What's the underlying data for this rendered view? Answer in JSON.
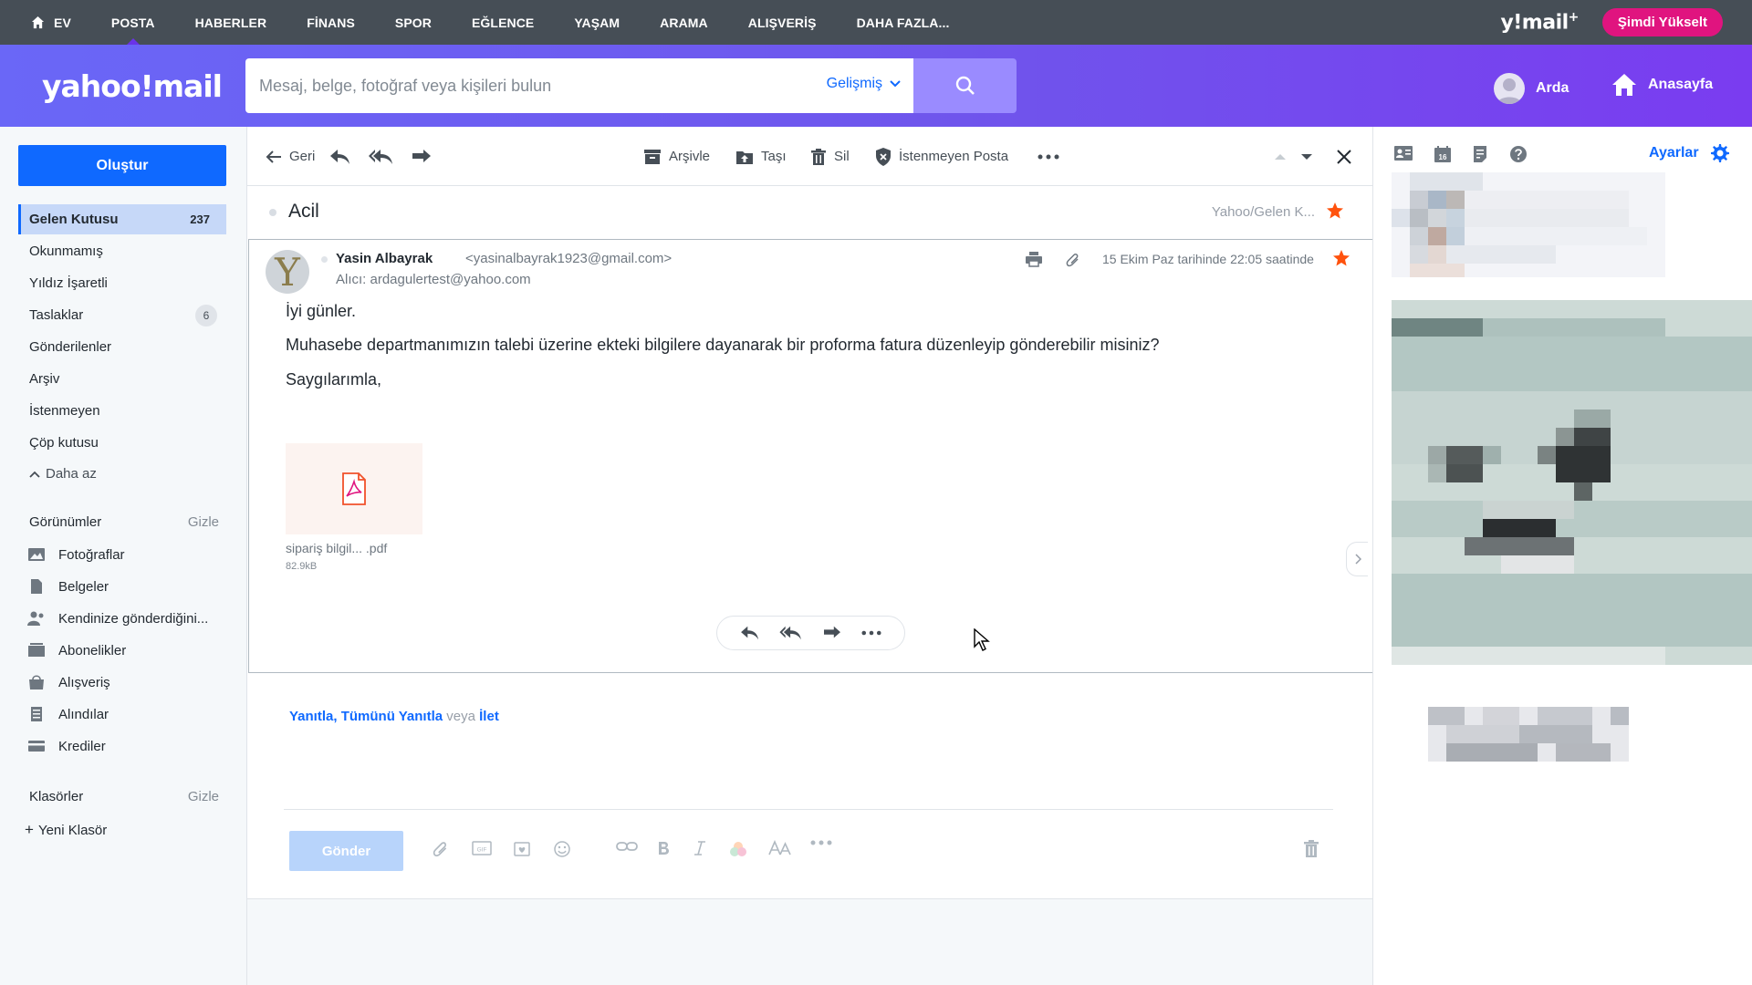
{
  "topnav": {
    "items": [
      "EV",
      "POSTA",
      "HABERLER",
      "FİNANS",
      "SPOR",
      "EĞLENCE",
      "YAŞAM",
      "ARAMA",
      "ALIŞVERİŞ",
      "DAHA FAZLA..."
    ],
    "brand": "y!mail",
    "brand_plus": "+",
    "upgrade": "Şimdi Yükselt"
  },
  "header": {
    "logo": "yahoo!mail",
    "search_placeholder": "Mesaj, belge, fotoğraf veya kişileri bulun",
    "advanced": "Gelişmiş",
    "user": "Arda",
    "homepage": "Anasayfa"
  },
  "sidebar": {
    "compose": "Oluştur",
    "folders": [
      {
        "label": "Gelen Kutusu",
        "count": "237"
      },
      {
        "label": "Okunmamış"
      },
      {
        "label": "Yıldız İşaretli"
      },
      {
        "label": "Taslaklar",
        "count": "6"
      },
      {
        "label": "Gönderilenler"
      },
      {
        "label": "Arşiv"
      },
      {
        "label": "İstenmeyen"
      },
      {
        "label": "Çöp kutusu"
      }
    ],
    "less": "Daha az",
    "views_title": "Görünümler",
    "views_hide": "Gizle",
    "views": [
      {
        "label": "Fotoğraflar",
        "icon": "photo-icon"
      },
      {
        "label": "Belgeler",
        "icon": "document-icon"
      },
      {
        "label": "Kendinize gönderdiğini...",
        "icon": "people-icon"
      },
      {
        "label": "Abonelikler",
        "icon": "subscriptions-icon"
      },
      {
        "label": "Alışveriş",
        "icon": "shopping-bag-icon"
      },
      {
        "label": "Alındılar",
        "icon": "receipt-icon"
      },
      {
        "label": "Krediler",
        "icon": "credit-card-icon"
      }
    ],
    "folders_title": "Klasörler",
    "folders_hide": "Gizle",
    "new_folder": "Yeni Klasör"
  },
  "toolbar": {
    "back": "Geri",
    "archive": "Arşivle",
    "move": "Taşı",
    "delete": "Sil",
    "spam": "İstenmeyen Posta"
  },
  "message": {
    "subject": "Acil",
    "folder_path": "Yahoo/Gelen K...",
    "sender_initial": "Y",
    "sender_name": "Yasin Albayrak",
    "sender_email": "<yasinalbayrak1923@gmail.com>",
    "recipient": "Alıcı: ardagulertest@yahoo.com",
    "date": "15 Ekim Paz tarihinde 22:05 saatinde",
    "body": [
      "İyi günler.",
      "Muhasebe departmanımızın talebi üzerine ekteki bilgilere dayanarak bir proforma fatura düzenleyip gönderebilir misiniz?",
      "Saygılarımla,"
    ],
    "attachment_name": "sipariş bilgil... .pdf",
    "attachment_size": "82.9kB"
  },
  "reply": {
    "reply": "Yanıtla",
    "comma": ",",
    "reply_all": "Tümünü Yanıtla",
    "or": "veya",
    "forward": "İlet",
    "send": "Gönder"
  },
  "rightpanel": {
    "settings": "Ayarlar"
  },
  "colors": {
    "accent": "#0f69ff",
    "topnav": "#464e56",
    "upgrade": "#e0147f",
    "star": "#ff520d"
  }
}
